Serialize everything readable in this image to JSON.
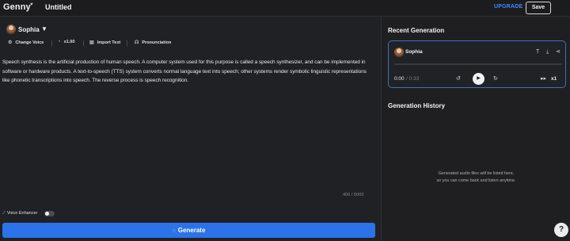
{
  "app": {
    "brand": "Genny",
    "title": "Untitled"
  },
  "header": {
    "upgrade_label": "UPGRADE",
    "save_label": "Save"
  },
  "voice": {
    "name": "Sophia"
  },
  "toolbar": {
    "change_voice": "Change Voice",
    "speed": "x1.00",
    "import_text": "Import Text",
    "pronunciation": "Pronunciation"
  },
  "editor": {
    "text": "Speech synthesis is the artificial production of human speech. A computer system used for this purpose is called a speech synthesizer, and can be implemented in software or hardware products. A text-to-speech (TTS) system converts normal language text into speech; other systems render symbolic linguistic representations like phonetic transcriptions into speech. The reverse process is speech recognition.",
    "char_count": "406 / 5000"
  },
  "enhancer": {
    "label": "Voice Enhancer",
    "enabled": false
  },
  "generate": {
    "label": "Generate"
  },
  "recent": {
    "title": "Recent Generation",
    "voice_name": "Sophia",
    "time_current": "0:00",
    "time_total": "/ 0:33",
    "speed": "x1",
    "progress": 0
  },
  "history": {
    "title": "Generation History",
    "empty_line1": "Generated audio files will be listed here,",
    "empty_line2": "so you can come back and listen anytime."
  },
  "help": {
    "label": "?"
  },
  "colors": {
    "accent": "#2b73e8",
    "upgrade": "#3b8cff",
    "card_border": "#3e6fbf"
  },
  "icons": [
    "heart-icon",
    "change-voice-icon",
    "speed-icon",
    "import-icon",
    "pronunciation-icon",
    "magic-wand-icon",
    "generate-icon",
    "text-icon",
    "download-icon",
    "share-icon",
    "rewind-icon",
    "play-icon",
    "forward-icon",
    "fast-forward-icon"
  ]
}
